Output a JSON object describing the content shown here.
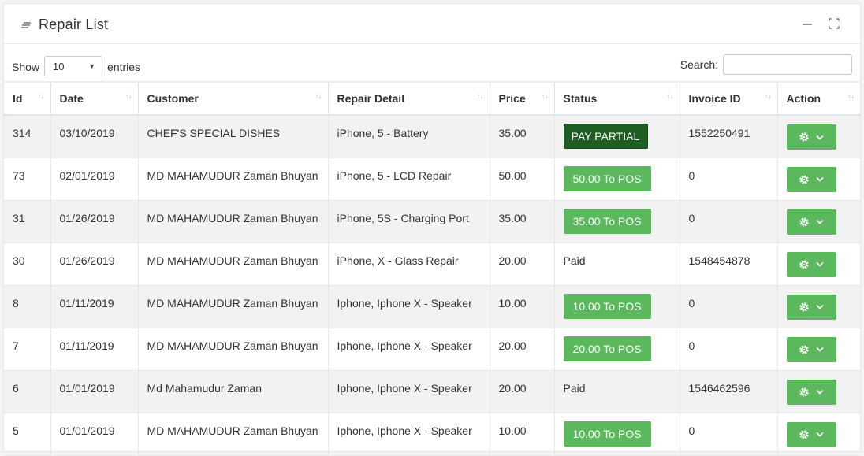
{
  "header": {
    "title": "Repair List"
  },
  "controls": {
    "show_label": "Show",
    "page_size": "10",
    "entries_label": "entries",
    "search_label": "Search:",
    "search_value": ""
  },
  "columns": [
    "Id",
    "Date",
    "Customer",
    "Repair Detail",
    "Price",
    "Status",
    "Invoice ID",
    "Action"
  ],
  "rows": [
    {
      "id": "314",
      "date": "03/10/2019",
      "customer": "CHEF'S SPECIAL DISHES",
      "detail": "iPhone, 5 - Battery",
      "price": "35.00",
      "status": "PAY PARTIAL",
      "status_type": "partial",
      "invoice": "1552250491"
    },
    {
      "id": "73",
      "date": "02/01/2019",
      "customer": "MD MAHAMUDUR Zaman Bhuyan",
      "detail": "iPhone, 5 - LCD Repair",
      "price": "50.00",
      "status": "50.00 To POS",
      "status_type": "pos",
      "invoice": "0"
    },
    {
      "id": "31",
      "date": "01/26/2019",
      "customer": "MD MAHAMUDUR Zaman Bhuyan",
      "detail": "iPhone, 5S - Charging Port",
      "price": "35.00",
      "status": "35.00 To POS",
      "status_type": "pos",
      "invoice": "0"
    },
    {
      "id": "30",
      "date": "01/26/2019",
      "customer": "MD MAHAMUDUR Zaman Bhuyan",
      "detail": "iPhone, X - Glass Repair",
      "price": "20.00",
      "status": "Paid",
      "status_type": "text",
      "invoice": "1548454878"
    },
    {
      "id": "8",
      "date": "01/11/2019",
      "customer": "MD MAHAMUDUR Zaman Bhuyan",
      "detail": "Iphone, Iphone X - Speaker",
      "price": "10.00",
      "status": "10.00 To POS",
      "status_type": "pos",
      "invoice": "0"
    },
    {
      "id": "7",
      "date": "01/11/2019",
      "customer": "MD MAHAMUDUR Zaman Bhuyan",
      "detail": "Iphone, Iphone X - Speaker",
      "price": "20.00",
      "status": "20.00 To POS",
      "status_type": "pos",
      "invoice": "0"
    },
    {
      "id": "6",
      "date": "01/01/2019",
      "customer": "Md Mahamudur Zaman",
      "detail": "Iphone, Iphone X - Speaker",
      "price": "20.00",
      "status": "Paid",
      "status_type": "text",
      "invoice": "1546462596"
    },
    {
      "id": "5",
      "date": "01/01/2019",
      "customer": "MD MAHAMUDUR Zaman Bhuyan",
      "detail": "Iphone, Iphone X - Speaker",
      "price": "10.00",
      "status": "10.00 To POS",
      "status_type": "pos",
      "invoice": "0"
    }
  ],
  "icons": {
    "title": "list-icon",
    "minimize": "minimize-icon",
    "fullscreen": "fullscreen-icon",
    "sort": "sort-icon",
    "action": "gear-icon",
    "dropdown": "chevron-down-icon"
  },
  "colors": {
    "pos_button": "#5cb85c",
    "partial_button": "#1e5e22",
    "action_button": "#5cb85c"
  }
}
